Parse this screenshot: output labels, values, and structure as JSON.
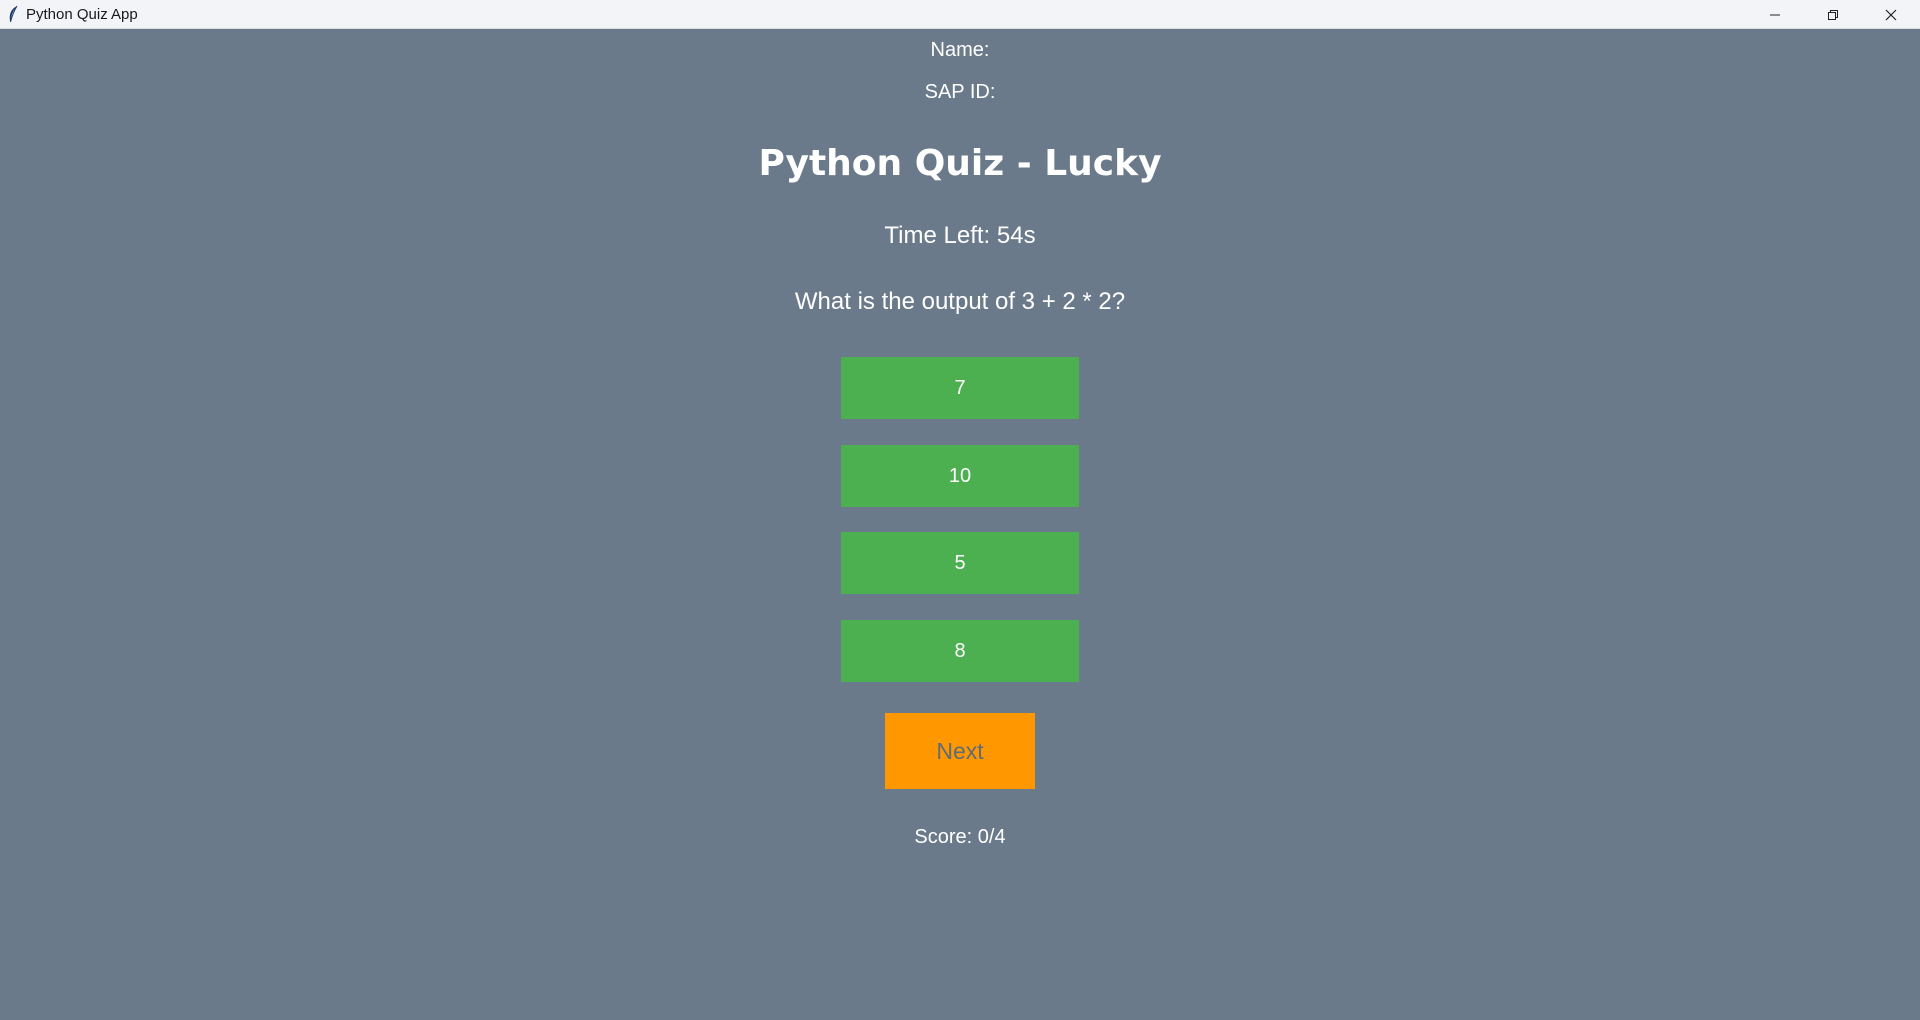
{
  "window": {
    "title": "Python Quiz App",
    "app_icon": "feather-icon"
  },
  "student": {
    "name_label": "Name:",
    "sap_label": "SAP ID:"
  },
  "quiz": {
    "title": "Python Quiz - Lucky",
    "timer_text": "Time Left: 54s",
    "question": "What is the output of 3 + 2 * 2?",
    "options": [
      "7",
      "10",
      "5",
      "8"
    ],
    "next_label": "Next",
    "score_text": "Score: 0/4"
  },
  "colors": {
    "background": "#6b7a8a",
    "option_button": "#4caf50",
    "next_button": "#ff9800",
    "text": "#ffffff"
  }
}
